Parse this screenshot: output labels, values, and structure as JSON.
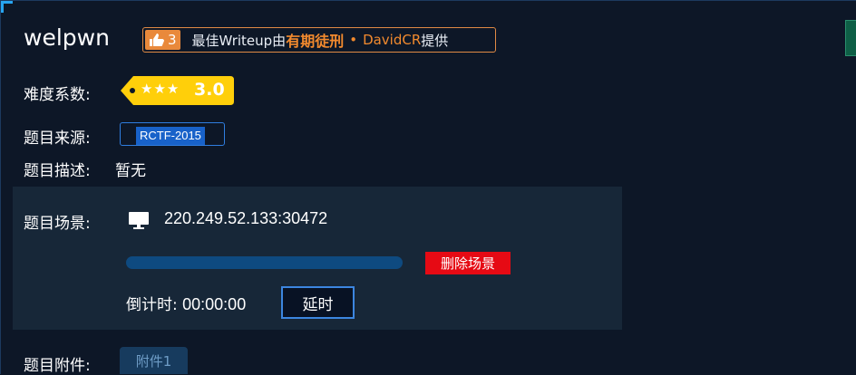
{
  "challenge": {
    "title": "welpwn"
  },
  "writeup_badge": {
    "like_count": "3",
    "prefix": "最佳Writeup由",
    "highlight": "有期徒刑",
    "dot": "•",
    "author": "DavidCR",
    "suffix": "提供"
  },
  "difficulty": {
    "label": "难度系数:",
    "stars": "★★★",
    "value": "3.0"
  },
  "source": {
    "label": "题目来源:",
    "value": "RCTF-2015"
  },
  "description": {
    "label": "题目描述:",
    "value": "暂无"
  },
  "scene": {
    "label": "题目场景:",
    "address": "220.249.52.133:30472",
    "progress": 1.0,
    "delete_label": "删除场景",
    "countdown_label": "倒计时:",
    "countdown_value": "00:00:00",
    "extend_label": "延时"
  },
  "attachment": {
    "label": "题目附件:",
    "file_label": "附件1"
  },
  "icons": {
    "thumb": "thumbs-up-icon",
    "monitor": "monitor-icon",
    "tag": "price-tag-icon"
  },
  "colors": {
    "background": "#0d1727",
    "panel": "#172738",
    "accent_orange": "#f28a2e",
    "tag_yellow": "#ffcf0a",
    "source_blue": "#1862c9",
    "delete_red": "#e60a14",
    "extend_border": "#3c86e0"
  }
}
